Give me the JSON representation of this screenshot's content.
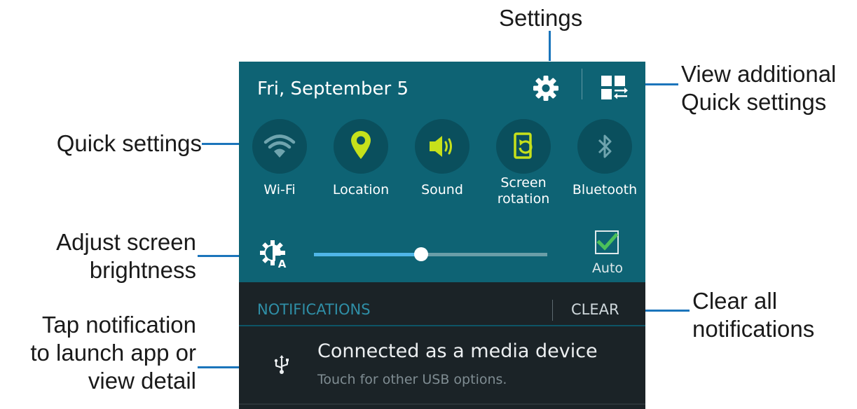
{
  "colors": {
    "panel_bg": "#0e6374",
    "quick_circle": "#0a4f5d",
    "active_icon": "#c6e11b",
    "inactive_icon": "#6fa4ae",
    "callout_line": "#1b75bb",
    "notif_bg": "#1b2327",
    "slider_fill": "#4fb6e8"
  },
  "callouts": {
    "settings": "Settings",
    "view_additional": [
      "View additional",
      "Quick settings"
    ],
    "quick_settings": "Quick settings",
    "adjust_brightness": [
      "Adjust screen",
      "brightness"
    ],
    "clear_all": [
      "Clear all",
      "notifications"
    ],
    "tap_notification": [
      "Tap notification",
      "to launch app or",
      "view detail"
    ]
  },
  "header": {
    "date": "Fri, September 5",
    "settings_icon": "gear-icon",
    "additional_icon": "grid-swap-icon"
  },
  "quick_settings": [
    {
      "label": "Wi-Fi",
      "icon": "wifi-icon",
      "active": false
    },
    {
      "label": "Location",
      "icon": "location-pin-icon",
      "active": true
    },
    {
      "label": "Sound",
      "icon": "speaker-icon",
      "active": true
    },
    {
      "label_lines": [
        "Screen",
        "rotation"
      ],
      "icon": "screen-rotation-icon",
      "active": true
    },
    {
      "label": "Bluetooth",
      "icon": "bluetooth-icon",
      "active": false
    }
  ],
  "brightness": {
    "icon": "brightness-auto-icon",
    "level": 0.46,
    "auto_label": "Auto",
    "auto_checked": true
  },
  "notifications": {
    "title": "NOTIFICATIONS",
    "clear_label": "CLEAR",
    "items": [
      {
        "icon": "usb-icon",
        "title": "Connected as a media device",
        "subtitle": "Touch for other USB options."
      }
    ]
  }
}
